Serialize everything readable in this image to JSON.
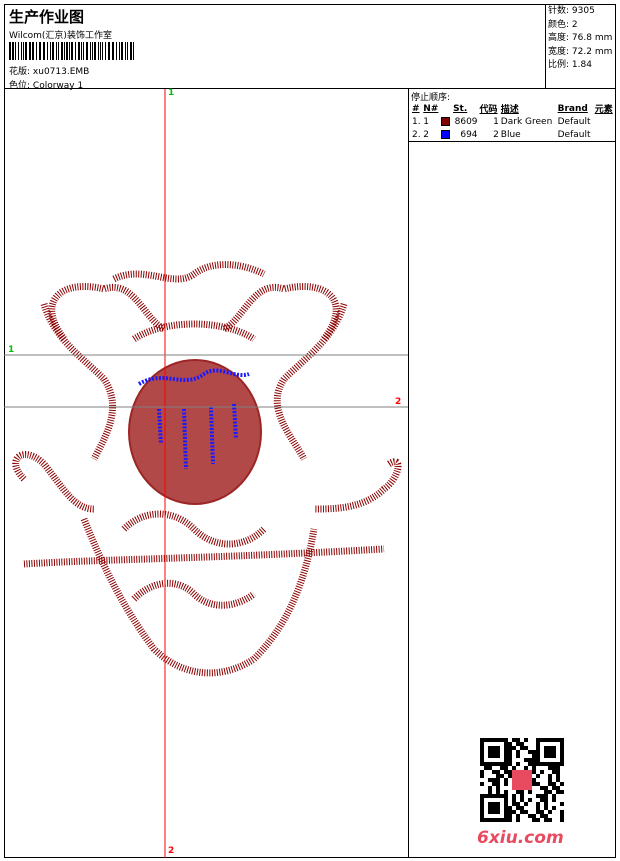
{
  "header": {
    "title": "生产作业图",
    "company": "Wilcom(汇京)装饰工作室",
    "design_label": "花版:",
    "design_value": "xu0713.EMB",
    "colorway_label": "色位:",
    "colorway_value": "Colorway 1"
  },
  "stats": [
    {
      "label": "针数:",
      "value": "9305"
    },
    {
      "label": "颜色:",
      "value": "2"
    },
    {
      "label": "高度:",
      "value": "76.8 mm"
    },
    {
      "label": "宽度:",
      "value": "72.2 mm"
    },
    {
      "label": "比例:",
      "value": "1.84"
    }
  ],
  "stop_sequence": {
    "title": "停止顺序:",
    "columns": [
      "#",
      "N#",
      "",
      "St.",
      "代码",
      "描述",
      "Brand",
      "元素"
    ],
    "rows": [
      {
        "idx": "1.",
        "n": "1",
        "color": "#800000",
        "st": "8609",
        "code": "1",
        "desc": "Dark Green",
        "brand": "Default"
      },
      {
        "idx": "2.",
        "n": "2",
        "color": "#0000ff",
        "st": "694",
        "code": "2",
        "desc": "Blue",
        "brand": "Default"
      }
    ]
  },
  "guides": {
    "v_top": "1",
    "v_bottom": "2",
    "h_left": "1",
    "h_right": "2",
    "v_color": "#ff0000",
    "h_color": "#808080",
    "label1_color": "#00c000",
    "label2_color": "#ff0000"
  },
  "watermark": {
    "site": "6xiu.com"
  }
}
